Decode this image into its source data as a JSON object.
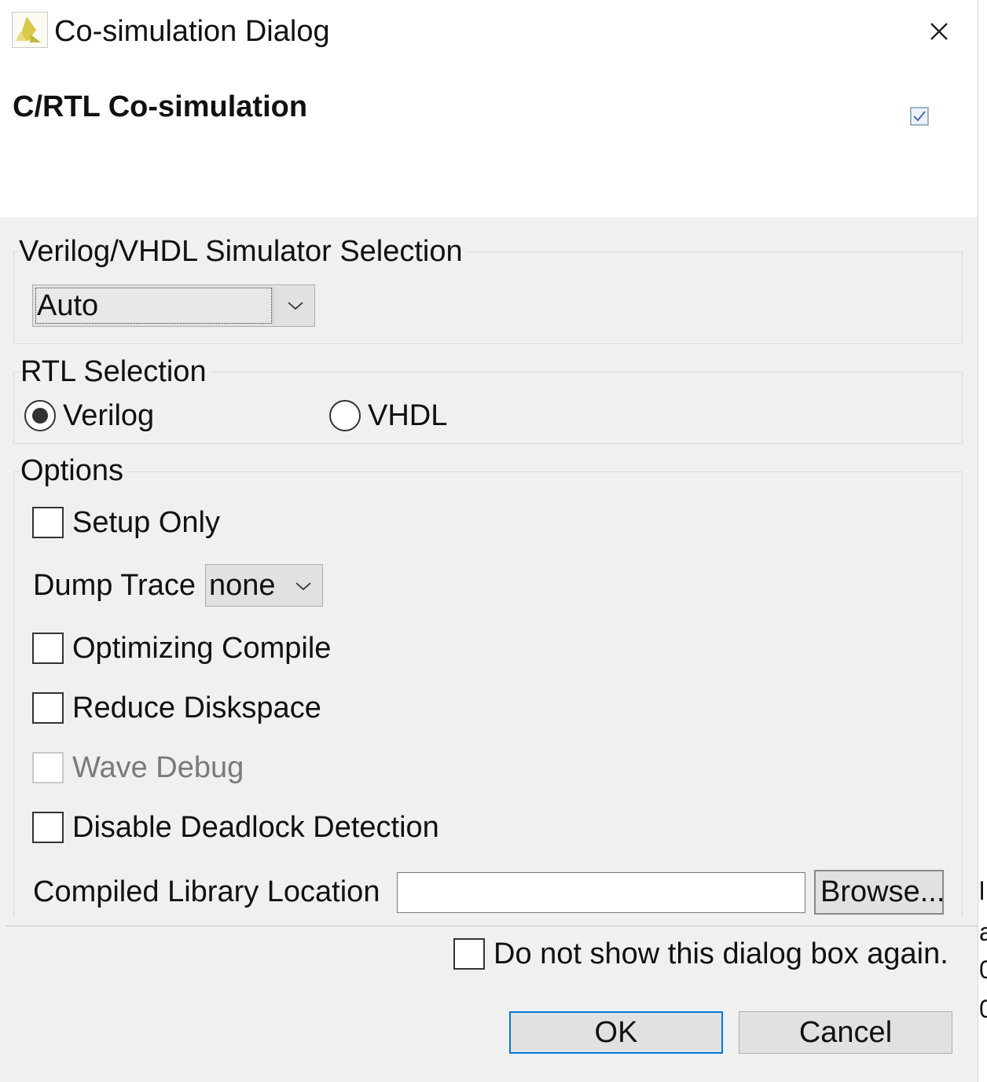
{
  "window": {
    "title": "Co-simulation Dialog"
  },
  "header": {
    "title": "C/RTL Co-simulation"
  },
  "simulator": {
    "group_title": "Verilog/VHDL Simulator Selection",
    "selected": "Auto"
  },
  "rtl": {
    "group_title": "RTL Selection",
    "options": [
      {
        "label": "Verilog",
        "selected": true
      },
      {
        "label": "VHDL",
        "selected": false
      }
    ]
  },
  "options": {
    "group_title": "Options",
    "setup_only": {
      "label": "Setup Only",
      "checked": false
    },
    "dump_trace": {
      "label": "Dump Trace",
      "selected": "none"
    },
    "optimizing_compile": {
      "label": "Optimizing Compile",
      "checked": false
    },
    "reduce_diskspace": {
      "label": "Reduce Diskspace",
      "checked": false
    },
    "wave_debug": {
      "label": "Wave Debug",
      "checked": false,
      "disabled": true
    },
    "disable_deadlock": {
      "label": "Disable Deadlock Detection",
      "checked": false
    },
    "compiled_library": {
      "label": "Compiled Library Location",
      "value": "",
      "browse_label": "Browse..."
    }
  },
  "footer": {
    "do_not_show_label": "Do not show this dialog box again.",
    "ok_label": "OK",
    "cancel_label": "Cancel"
  },
  "colors": {
    "panel_bg": "#f0f0f0",
    "button_bg": "#e1e1e1",
    "ok_border": "#0078d7",
    "logo_yellow": "#d9c94a"
  },
  "icons": {
    "app": "xilinx-logo-icon",
    "close": "close-icon",
    "header_check": "checkmark-icon",
    "dropdown": "chevron-down-icon"
  }
}
